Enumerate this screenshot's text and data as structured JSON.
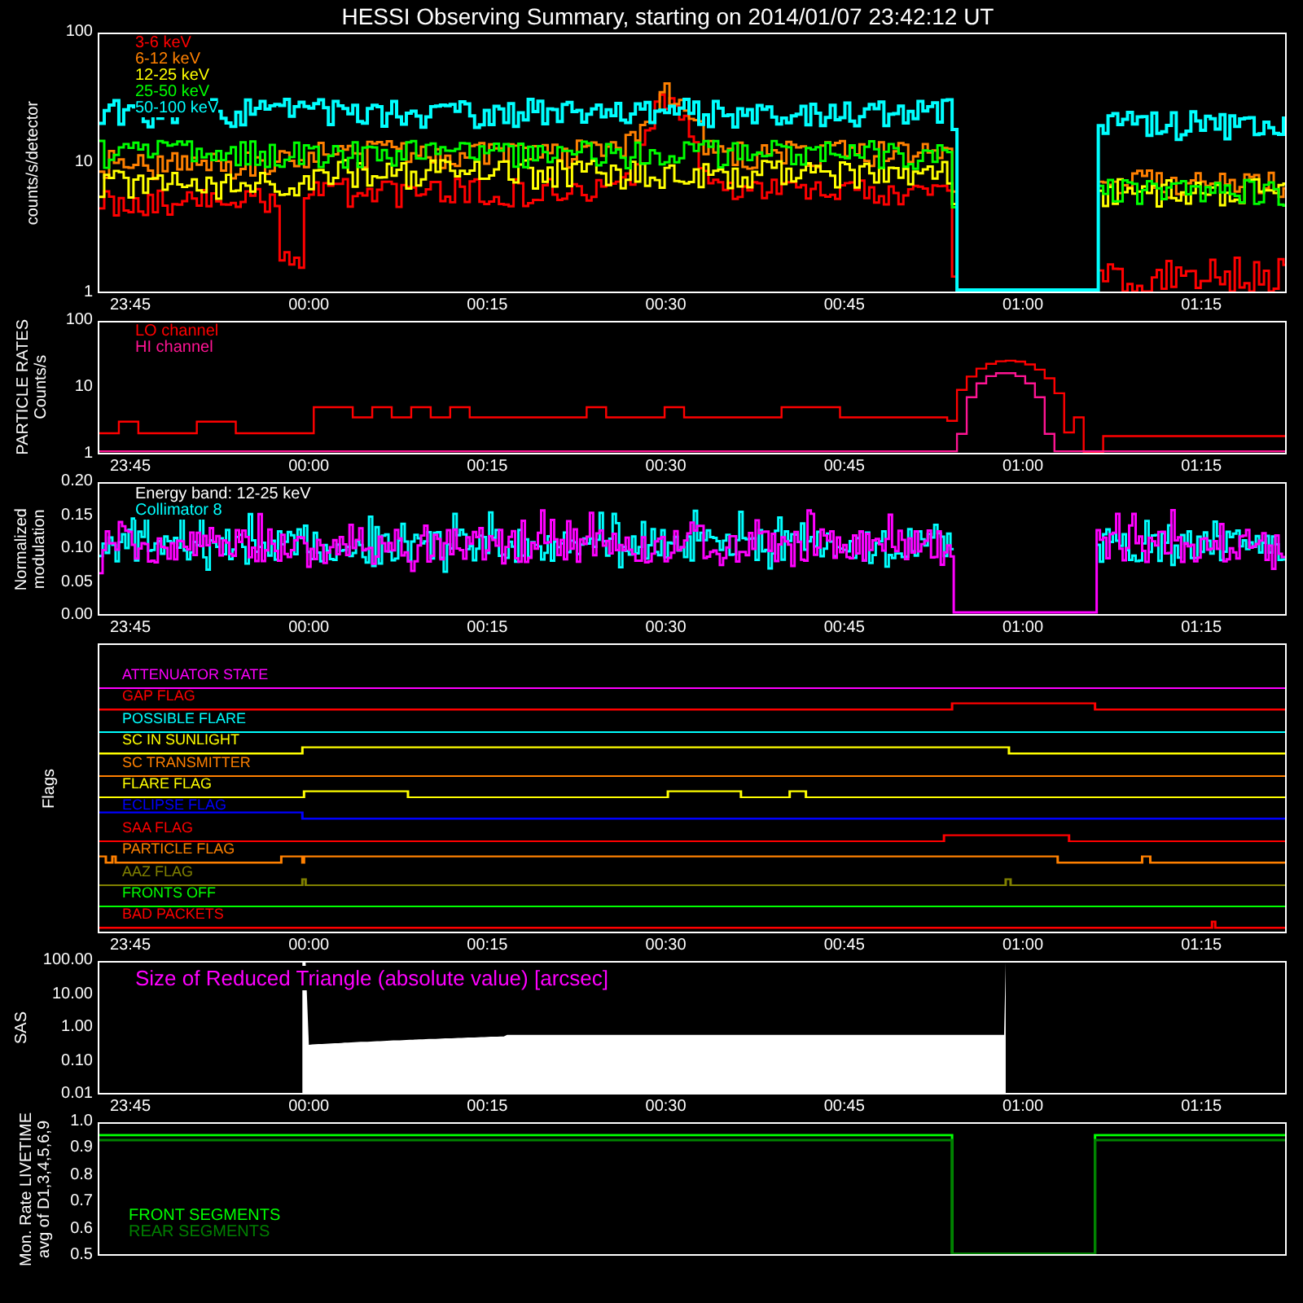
{
  "title": "HESSI Observing Summary, starting on 2014/01/07 23:42:12 UT",
  "panels": [
    {
      "kind": "rates",
      "ylabel": [
        "counts/s/detector"
      ],
      "yticks": [
        "100",
        "10",
        "1"
      ],
      "xticks": [
        "23:45",
        "00:00",
        "00:15",
        "00:30",
        "00:45",
        "01:00",
        "01:15"
      ],
      "legend": [
        {
          "label": "3-6 keV",
          "color": "#ff0000"
        },
        {
          "label": "6-12 keV",
          "color": "#ff8000"
        },
        {
          "label": "12-25 keV",
          "color": "#ffff00"
        },
        {
          "label": "25-50 keV",
          "color": "#00ff00"
        },
        {
          "label": "50-100 keV",
          "color": "#00ffff"
        }
      ]
    },
    {
      "kind": "particle",
      "ylabel": [
        "PARTICLE RATES",
        "Counts/s"
      ],
      "yticks": [
        "100",
        "10",
        "1"
      ],
      "xticks": [
        "23:45",
        "00:00",
        "00:15",
        "00:30",
        "00:45",
        "01:00",
        "01:15"
      ],
      "legend": [
        {
          "label": "LO channel",
          "color": "#ff0000"
        },
        {
          "label": "HI channel",
          "color": "#ff1493"
        }
      ]
    },
    {
      "kind": "modulation",
      "ylabel": [
        "Normalized",
        "modulation"
      ],
      "yticks": [
        "0.20",
        "0.15",
        "0.10",
        "0.05",
        "0.00"
      ],
      "xticks": [
        "23:45",
        "00:00",
        "00:15",
        "00:30",
        "00:45",
        "01:00",
        "01:15"
      ],
      "legend": [
        {
          "label": "Energy band: 12-25 keV",
          "color": "#ffffff"
        },
        {
          "label": "Collimator 8",
          "color": "#00ffff"
        }
      ]
    },
    {
      "kind": "flags",
      "ylabel": [
        "Flags"
      ],
      "xticks": [
        "23:45",
        "00:00",
        "00:15",
        "00:30",
        "00:45",
        "01:00",
        "01:15"
      ],
      "legend": [
        {
          "label": "ATTENUATOR STATE",
          "color": "#ff00ff"
        },
        {
          "label": "GAP FLAG",
          "color": "#ff0000"
        },
        {
          "label": "POSSIBLE FLARE",
          "color": "#00ffff"
        },
        {
          "label": "SC IN SUNLIGHT",
          "color": "#ffff00"
        },
        {
          "label": "SC TRANSMITTER",
          "color": "#ff8000"
        },
        {
          "label": "FLARE FLAG",
          "color": "#ffff00"
        },
        {
          "label": "ECLIPSE FLAG",
          "color": "#0000ff"
        },
        {
          "label": "SAA FLAG",
          "color": "#ff0000"
        },
        {
          "label": "PARTICLE FLAG",
          "color": "#ff8000"
        },
        {
          "label": "AAZ FLAG",
          "color": "#808000"
        },
        {
          "label": "FRONTS OFF",
          "color": "#00ff00"
        },
        {
          "label": "BAD PACKETS",
          "color": "#ff0000"
        }
      ]
    },
    {
      "kind": "sas",
      "ylabel": [
        "SAS"
      ],
      "yticks": [
        "100.00",
        "10.00",
        "1.00",
        "0.10",
        "0.01"
      ],
      "xticks": [
        "23:45",
        "00:00",
        "00:15",
        "00:30",
        "00:45",
        "01:00",
        "01:15"
      ],
      "legend": [
        {
          "label": "Size of Reduced Triangle (absolute value) [arcsec]",
          "color": "#ff00ff"
        }
      ]
    },
    {
      "kind": "livetime",
      "ylabel": [
        "Mon. Rate LIVETIME",
        "avg of D1,3,4,5,6,9"
      ],
      "yticks": [
        "1.0",
        "0.9",
        "0.8",
        "0.7",
        "0.6",
        "0.5"
      ],
      "legend": [
        {
          "label": "FRONT SEGMENTS",
          "color": "#00ff00"
        },
        {
          "label": "REAR SEGMENTS",
          "color": "#008000"
        }
      ]
    }
  ]
}
